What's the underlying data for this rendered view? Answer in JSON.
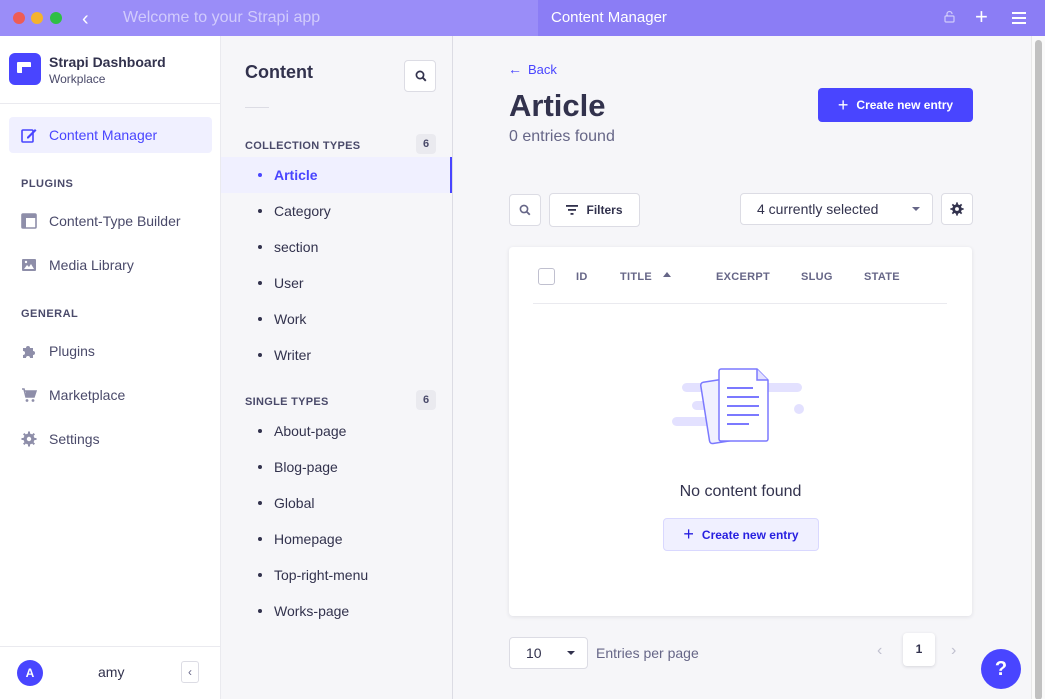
{
  "window": {
    "left_title": "Welcome to your Strapi app",
    "right_title": "Content Manager"
  },
  "brand": {
    "name": "Strapi Dashboard",
    "workspace": "Workplace"
  },
  "mainnav": {
    "content_manager": "Content Manager",
    "plugins_section": "PLUGINS",
    "ctb": "Content-Type Builder",
    "media": "Media Library",
    "general_section": "GENERAL",
    "plugins": "Plugins",
    "marketplace": "Marketplace",
    "settings": "Settings"
  },
  "user": {
    "initial": "A",
    "name": "amy"
  },
  "subnav": {
    "title": "Content",
    "collection_title": "COLLECTION TYPES",
    "collection_count": "6",
    "collection_items": [
      "Article",
      "Category",
      "section",
      "User",
      "Work",
      "Writer"
    ],
    "single_title": "SINGLE TYPES",
    "single_count": "6",
    "single_items": [
      "About-page",
      "Blog-page",
      "Global",
      "Homepage",
      "Top-right-menu",
      "Works-page"
    ]
  },
  "main": {
    "back": "Back",
    "title": "Article",
    "count": "0 entries found",
    "create": "Create new entry",
    "filters": "Filters",
    "columns_selected": "4 currently selected",
    "headers": {
      "id": "ID",
      "title": "TITLE",
      "excerpt": "EXCERPT",
      "slug": "SLUG",
      "state": "STATE"
    },
    "empty_text": "No content found",
    "empty_create": "Create new entry",
    "page_size": "10",
    "per_page_label": "Entries per page",
    "current_page": "1"
  },
  "help": "?",
  "colors": {
    "primary": "#4945ff",
    "titlebar": "#8b7df5"
  }
}
